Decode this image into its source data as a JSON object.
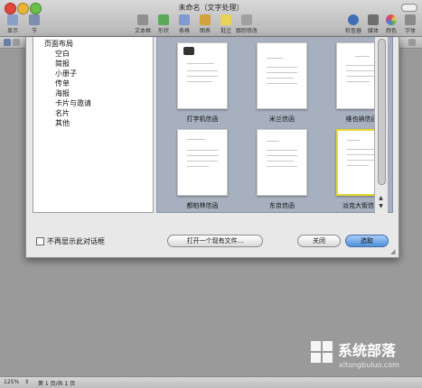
{
  "window": {
    "title": "未命名（文字处理）"
  },
  "toolbar": {
    "left": [
      {
        "label": "显示",
        "icon": "sidebar-icon"
      },
      {
        "label": "节",
        "icon": "sections-icon"
      }
    ],
    "items": [
      {
        "label": "文本框",
        "icon": "textbox-icon",
        "color": "#8f8f8f"
      },
      {
        "label": "形状",
        "icon": "shapes-icon",
        "color": "#5aa85a"
      },
      {
        "label": "表格",
        "icon": "table-icon",
        "color": "#7d9bd1"
      },
      {
        "label": "图表",
        "icon": "chart-icon",
        "color": "#d4a23a"
      },
      {
        "label": "批注",
        "icon": "comment-icon",
        "color": "#e8d25a"
      },
      {
        "label": "跟踪修改",
        "icon": "track-changes-icon",
        "color": "#a0a0a0"
      }
    ],
    "right": [
      {
        "label": "检查器",
        "icon": "inspector-icon",
        "color": "#3f6fb5"
      },
      {
        "label": "媒体",
        "icon": "media-icon",
        "color": "#6e6e6e"
      },
      {
        "label": "颜色",
        "icon": "colors-icon",
        "color": "#c84a8a"
      },
      {
        "label": "字体",
        "icon": "fonts-icon",
        "color": "#8a8a8a"
      }
    ]
  },
  "sheet": {
    "categories": [
      {
        "label": "页面布局",
        "type": "head"
      },
      {
        "label": "空白",
        "type": "sub"
      },
      {
        "label": "简报",
        "type": "sub"
      },
      {
        "label": "小册子",
        "type": "sub"
      },
      {
        "label": "传单",
        "type": "sub"
      },
      {
        "label": "海报",
        "type": "sub"
      },
      {
        "label": "卡片与邀请",
        "type": "sub"
      },
      {
        "label": "名片",
        "type": "sub"
      },
      {
        "label": "其他",
        "type": "sub"
      }
    ],
    "templates": [
      {
        "label": "打字机信函",
        "selected": false
      },
      {
        "label": "米兰信函",
        "selected": false
      },
      {
        "label": "维也纳信函",
        "selected": false
      },
      {
        "label": "都柏林信函",
        "selected": false
      },
      {
        "label": "东京信函",
        "selected": false
      },
      {
        "label": "派克大街信函",
        "selected": true
      }
    ],
    "dont_show_label": "不再显示此对话框",
    "open_existing_label": "打开一个现有文件...",
    "close_label": "关闭",
    "choose_label": "选取"
  },
  "status": {
    "zoom": "125%",
    "pages": "第 1 页/共 1 页"
  },
  "watermark": {
    "main": "系统部落",
    "sub": "xitongbuluo.com"
  }
}
